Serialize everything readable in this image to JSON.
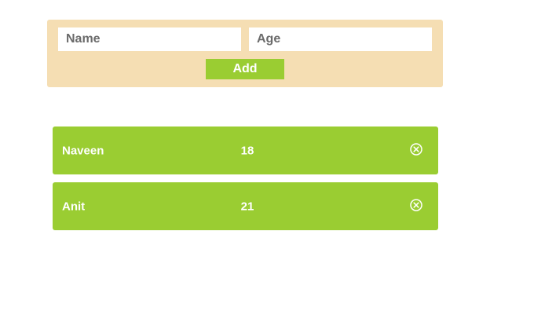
{
  "form": {
    "name_placeholder": "Name",
    "age_placeholder": "Age",
    "add_label": "Add"
  },
  "people": [
    {
      "name": "Naveen",
      "age": "18",
      "remove_icon": "close-circle-icon"
    },
    {
      "name": "Anit",
      "age": "21",
      "remove_icon": "close-circle-icon"
    }
  ],
  "colors": {
    "form_background": "#f5deb3",
    "accent": "#9acd32",
    "text_on_accent": "#ffffff"
  }
}
